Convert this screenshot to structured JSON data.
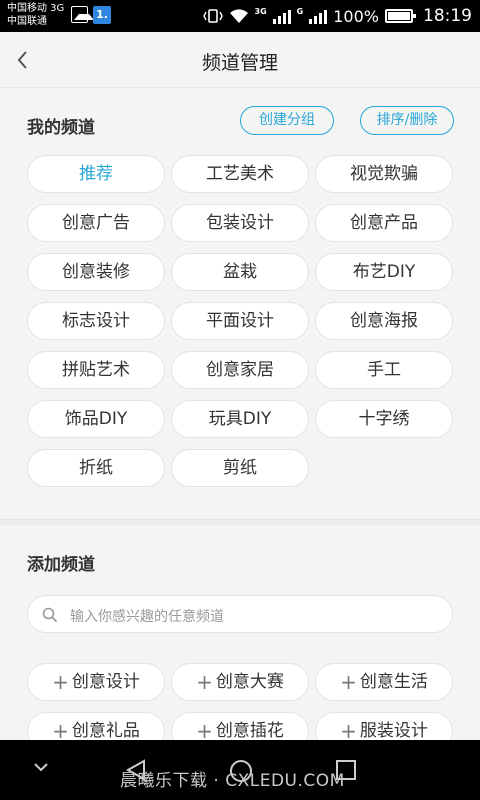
{
  "status_bar": {
    "carrier_line1": "中国移动 3G",
    "carrier_line2": "中国联通",
    "app_badge": "1.",
    "network_3g": "3G",
    "network_g": "G",
    "battery_percent": "100%",
    "time": "18:19"
  },
  "header": {
    "title": "频道管理"
  },
  "my_channels": {
    "title": "我的频道",
    "create_group_label": "创建分组",
    "sort_delete_label": "排序/删除",
    "items": [
      {
        "label": "推荐"
      },
      {
        "label": "工艺美术"
      },
      {
        "label": "视觉欺骗"
      },
      {
        "label": "创意广告"
      },
      {
        "label": "包装设计"
      },
      {
        "label": "创意产品"
      },
      {
        "label": "创意装修"
      },
      {
        "label": "盆栽"
      },
      {
        "label": "布艺DIY"
      },
      {
        "label": "标志设计"
      },
      {
        "label": "平面设计"
      },
      {
        "label": "创意海报"
      },
      {
        "label": "拼贴艺术"
      },
      {
        "label": "创意家居"
      },
      {
        "label": "手工"
      },
      {
        "label": "饰品DIY"
      },
      {
        "label": "玩具DIY"
      },
      {
        "label": "十字绣"
      },
      {
        "label": "折纸"
      },
      {
        "label": "剪纸"
      }
    ]
  },
  "add_channels": {
    "title": "添加频道",
    "search_placeholder": "输入你感兴趣的任意频道",
    "items": [
      {
        "label": "创意设计"
      },
      {
        "label": "创意大赛"
      },
      {
        "label": "创意生活"
      },
      {
        "label": "创意礼品"
      },
      {
        "label": "创意插花"
      },
      {
        "label": "服装设计"
      }
    ]
  },
  "nav_bar": {
    "watermark": "晨曦乐下载 · CXLEDU.COM"
  },
  "colors": {
    "accent": "#2aa7d6",
    "background": "#f4f4f4",
    "chip_bg": "#ffffff"
  }
}
